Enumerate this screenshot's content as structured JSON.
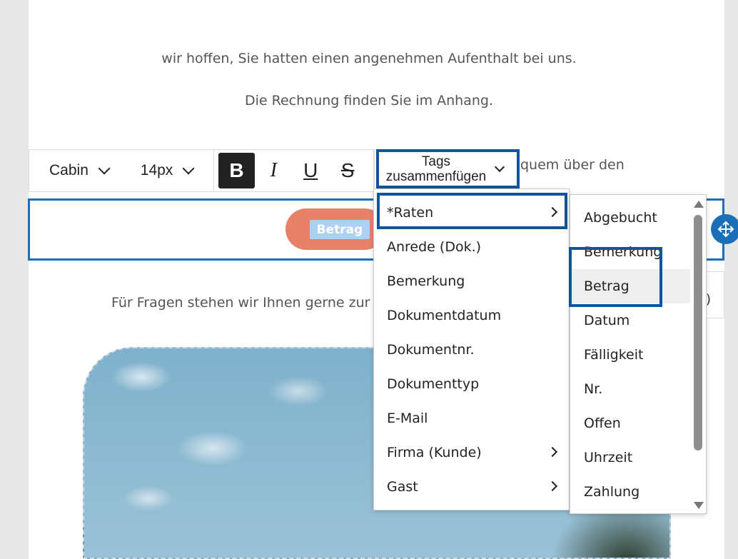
{
  "email": {
    "line1": "wir hoffen, Sie hatten einen angenehmen Aufenthalt bei uns.",
    "line2": "Die Rechnung finden Sie im Anhang.",
    "line3_partial": "quem über den",
    "line4_partial": "Für Fragen stehen wir Ihnen gerne zur Ver",
    "button_tag": "Betrag"
  },
  "toolbar": {
    "font_family": "Cabin",
    "font_size": "14px",
    "bold_label": "B",
    "italic_label": "I",
    "underline_label": "U",
    "strike_label": "S",
    "tags_label": "Tags zusammenfügen"
  },
  "menu": {
    "items": [
      {
        "label": "*Raten",
        "has_submenu": true
      },
      {
        "label": "Anrede (Dok.)",
        "has_submenu": false
      },
      {
        "label": "Bemerkung",
        "has_submenu": false
      },
      {
        "label": "Dokumentdatum",
        "has_submenu": false
      },
      {
        "label": "Dokumentnr.",
        "has_submenu": false
      },
      {
        "label": "Dokumenttyp",
        "has_submenu": false
      },
      {
        "label": "E-Mail",
        "has_submenu": false
      },
      {
        "label": "Firma (Kunde)",
        "has_submenu": true
      },
      {
        "label": "Gast",
        "has_submenu": true
      }
    ]
  },
  "submenu": {
    "items": [
      {
        "label": "Abgebucht"
      },
      {
        "label": "Bemerkung"
      },
      {
        "label": "Betrag"
      },
      {
        "label": "Datum"
      },
      {
        "label": "Fälligkeit"
      },
      {
        "label": "Nr."
      },
      {
        "label": "Offen"
      },
      {
        "label": "Uhrzeit"
      },
      {
        "label": "Zahlung"
      }
    ]
  },
  "side_card_glyph": ")",
  "colors": {
    "highlight": "#0f5599",
    "selection": "#1a6fb8",
    "button": "#e7816a",
    "tag": "#aed0f5"
  }
}
